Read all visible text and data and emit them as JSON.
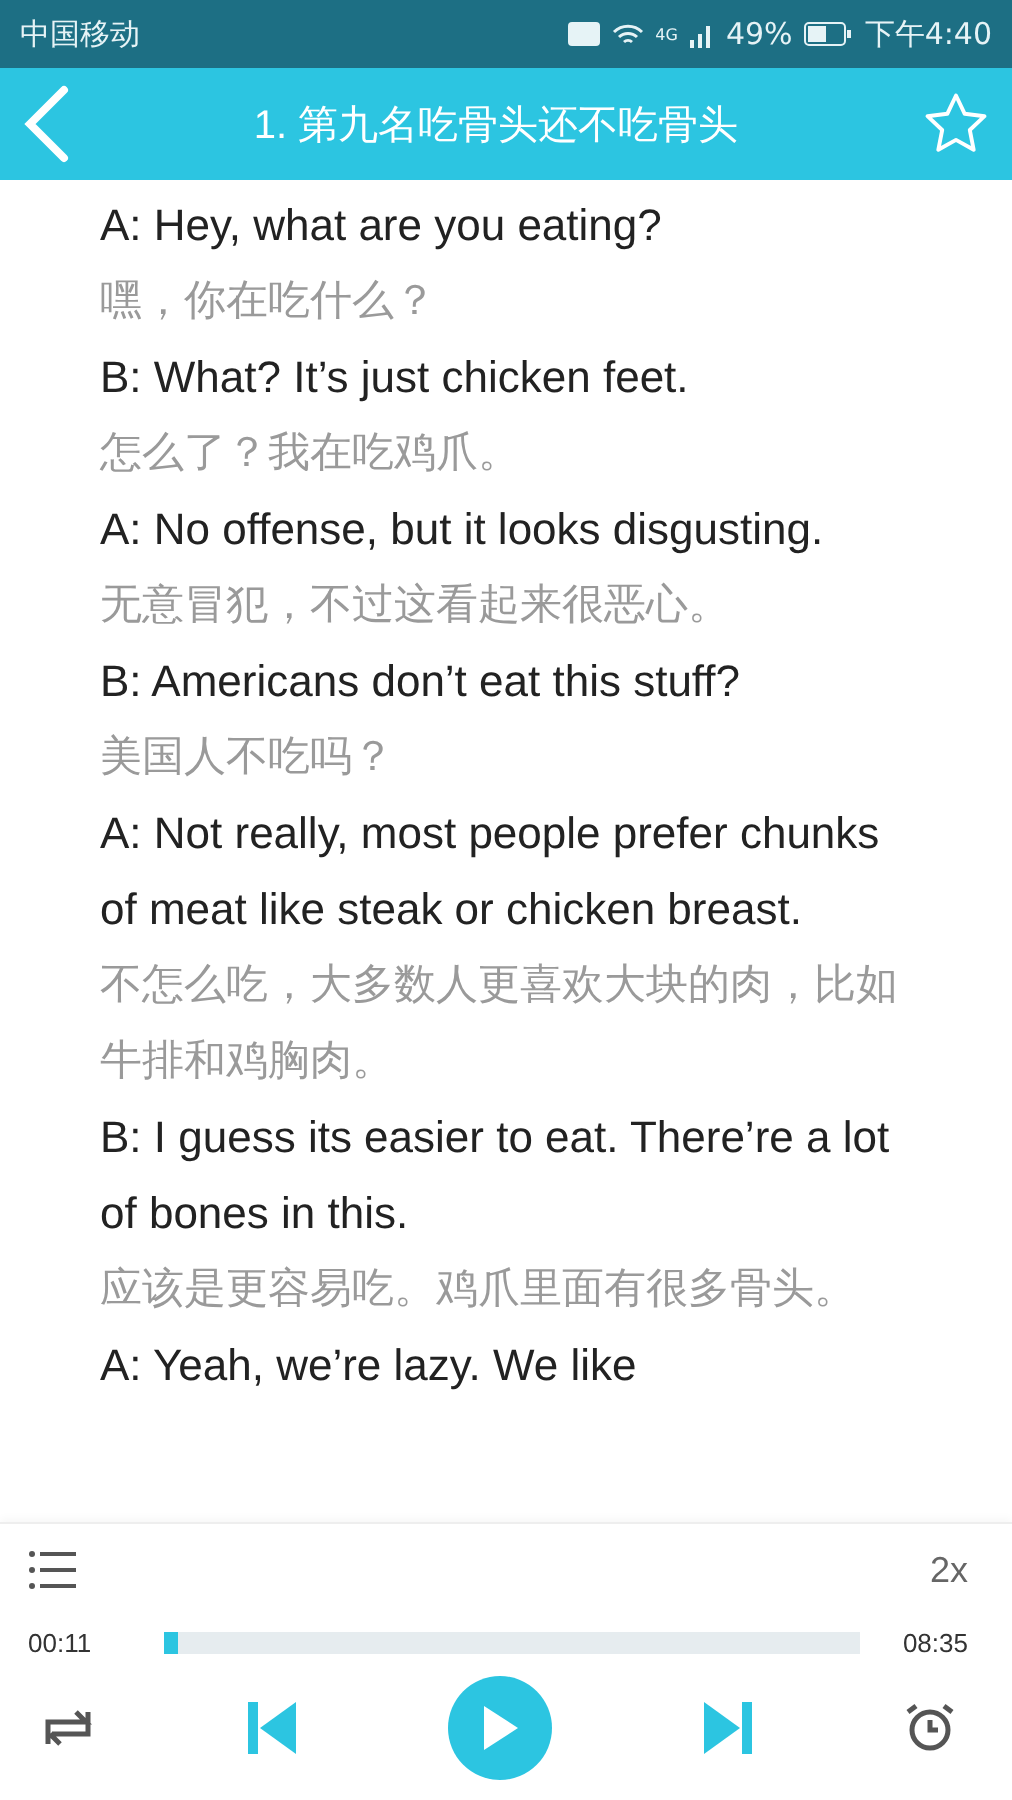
{
  "status_bar": {
    "carrier": "中国移动",
    "network": "4G",
    "battery": "49%",
    "time": "下午4:40"
  },
  "header": {
    "title": "1. 第九名吃骨头还不吃骨头",
    "favorite": false
  },
  "dialogue": [
    {
      "english": "A: Hey, what are you eating?",
      "chinese": "嘿，你在吃什么？"
    },
    {
      "english": "B: What? It’s just chicken feet.",
      "chinese": "怎么了？我在吃鸡爪。"
    },
    {
      "english": "A: No offense, but it looks disgusting.",
      "chinese": "无意冒犯，不过这看起来很恶心。"
    },
    {
      "english": "B: Americans don’t eat this stuff?",
      "chinese": "美国人不吃吗？"
    },
    {
      "english": "A: Not really, most people prefer chunks of meat like steak or chicken breast.",
      "chinese": "不怎么吃，大多数人更喜欢大块的肉，比如牛排和鸡胸肉。"
    },
    {
      "english": "B: I guess its easier to eat. There’re a lot of bones in this.",
      "chinese": "应该是更容易吃。鸡爪里面有很多骨头。"
    },
    {
      "english": "A: Yeah, we’re lazy. We like"
    }
  ],
  "player": {
    "speed": "2x",
    "elapsed": "00:11",
    "total": "08:35",
    "level": 0.02,
    "playing": false
  }
}
